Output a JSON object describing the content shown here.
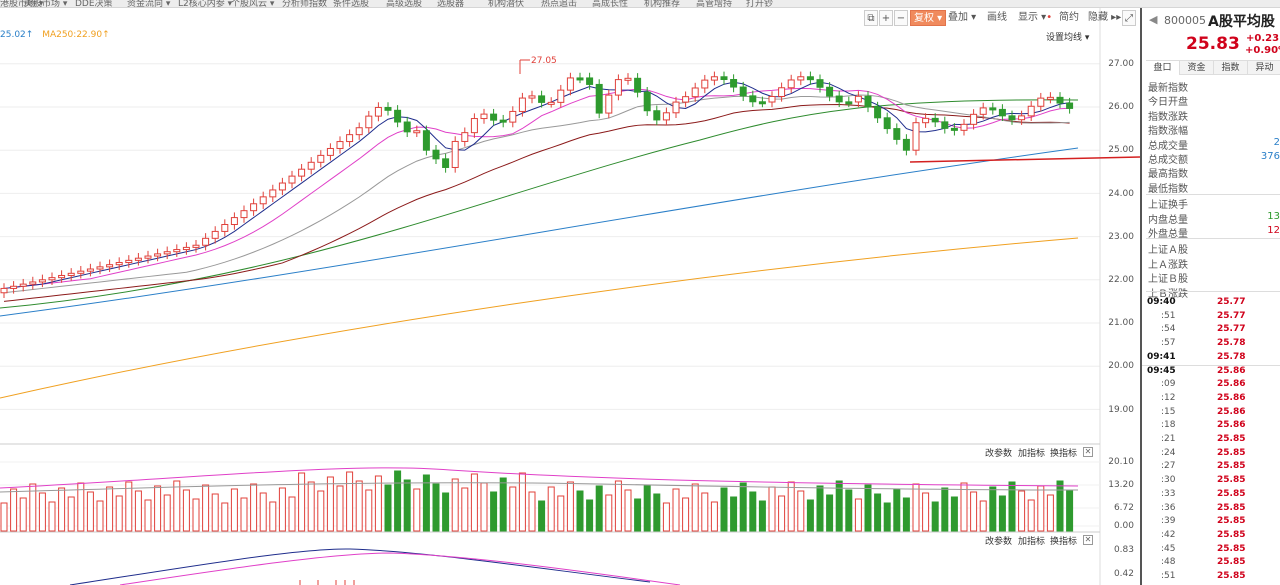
{
  "menu": {
    "items": [
      "港股市场 ▾",
      "美股市场 ▾",
      "DDE决策",
      "资金流向 ▾",
      "L2核心内参 ▾",
      "个股风云 ▾",
      "分析师指数",
      "条件选股",
      "高级选股",
      "选股器",
      "机构潜伏",
      "热点追击",
      "高成长性",
      "机构推荐",
      "高管增持",
      "打开钞"
    ]
  },
  "toolbar": {
    "fuquan": "复权",
    "add": "叠加",
    "draw": "画线",
    "display": "显示",
    "brief": "简约",
    "hide": "隐藏"
  },
  "legend": {
    "ma_left": "25.02",
    "ma250": "MA250:22.90",
    "settings": "设置均线"
  },
  "price_axis": [
    "27.00",
    "26.00",
    "25.00",
    "24.00",
    "23.00",
    "22.00",
    "21.00",
    "20.00",
    "19.00"
  ],
  "annotations": {
    "high": "27.05"
  },
  "volume_panel": {
    "axis": [
      "20.10",
      "13.20",
      "6.72",
      "0.00"
    ],
    "change_params": "改参数",
    "add_indicator": "加指标",
    "switch_indicator": "换指标"
  },
  "macd_panel": {
    "axis": [
      "0.83",
      "0.42"
    ],
    "change_params": "改参数",
    "add_indicator": "加指标",
    "switch_indicator": "换指标"
  },
  "quote": {
    "code": "800005",
    "name": "A股平均股",
    "price": "25.83",
    "change": "+0.23",
    "change_pct": "+0.90%",
    "tabs": [
      "盘口",
      "资金",
      "指数",
      "异动"
    ],
    "fields": [
      {
        "label": "最新指数",
        "value": ""
      },
      {
        "label": "今日开盘",
        "value": ""
      },
      {
        "label": "指数涨跌",
        "value": ""
      },
      {
        "label": "指数涨幅",
        "value": ""
      },
      {
        "label": "总成交量",
        "value": "2"
      },
      {
        "label": "总成交额",
        "value": "376"
      },
      {
        "label": "最高指数",
        "value": ""
      },
      {
        "label": "最低指数",
        "value": ""
      },
      {
        "label": "上证换手",
        "value": ""
      },
      {
        "label": "内盘总量",
        "value": "13"
      },
      {
        "label": "外盘总量",
        "value": "12"
      },
      {
        "label": "上证Ａ股",
        "value": ""
      },
      {
        "label": "上Ａ涨跌",
        "value": ""
      },
      {
        "label": "上证Ｂ股",
        "value": ""
      },
      {
        "label": "上Ｂ涨跌",
        "value": ""
      }
    ],
    "ticks": [
      {
        "time": "09:40",
        "price": "25.77"
      },
      {
        "time": ":51",
        "price": "25.77"
      },
      {
        "time": ":54",
        "price": "25.77"
      },
      {
        "time": ":57",
        "price": "25.78"
      },
      {
        "time": "09:41",
        "price": "25.78"
      },
      {
        "time": "09:45",
        "price": "25.86"
      },
      {
        "time": ":09",
        "price": "25.86"
      },
      {
        "time": ":12",
        "price": "25.86"
      },
      {
        "time": ":15",
        "price": "25.86"
      },
      {
        "time": ":18",
        "price": "25.86"
      },
      {
        "time": ":21",
        "price": "25.85"
      },
      {
        "time": ":24",
        "price": "25.85"
      },
      {
        "time": ":27",
        "price": "25.85"
      },
      {
        "time": ":30",
        "price": "25.85"
      },
      {
        "time": ":33",
        "price": "25.85"
      },
      {
        "time": ":36",
        "price": "25.85"
      },
      {
        "time": ":39",
        "price": "25.85"
      },
      {
        "time": ":42",
        "price": "25.85"
      },
      {
        "time": ":45",
        "price": "25.85"
      },
      {
        "time": ":48",
        "price": "25.85"
      },
      {
        "time": ":51",
        "price": "25.85"
      }
    ]
  },
  "colors": {
    "up": "#e0403a",
    "down": "#2e9a2e",
    "accent": "#d0021b",
    "ma5": "#1f2d8c",
    "ma10": "#e040c8",
    "ma20": "#999999",
    "ma30": "#8b1a1a",
    "ma60": "#2e8b2e",
    "ma120": "#2a7fc8",
    "ma250": "#f0a020"
  }
}
